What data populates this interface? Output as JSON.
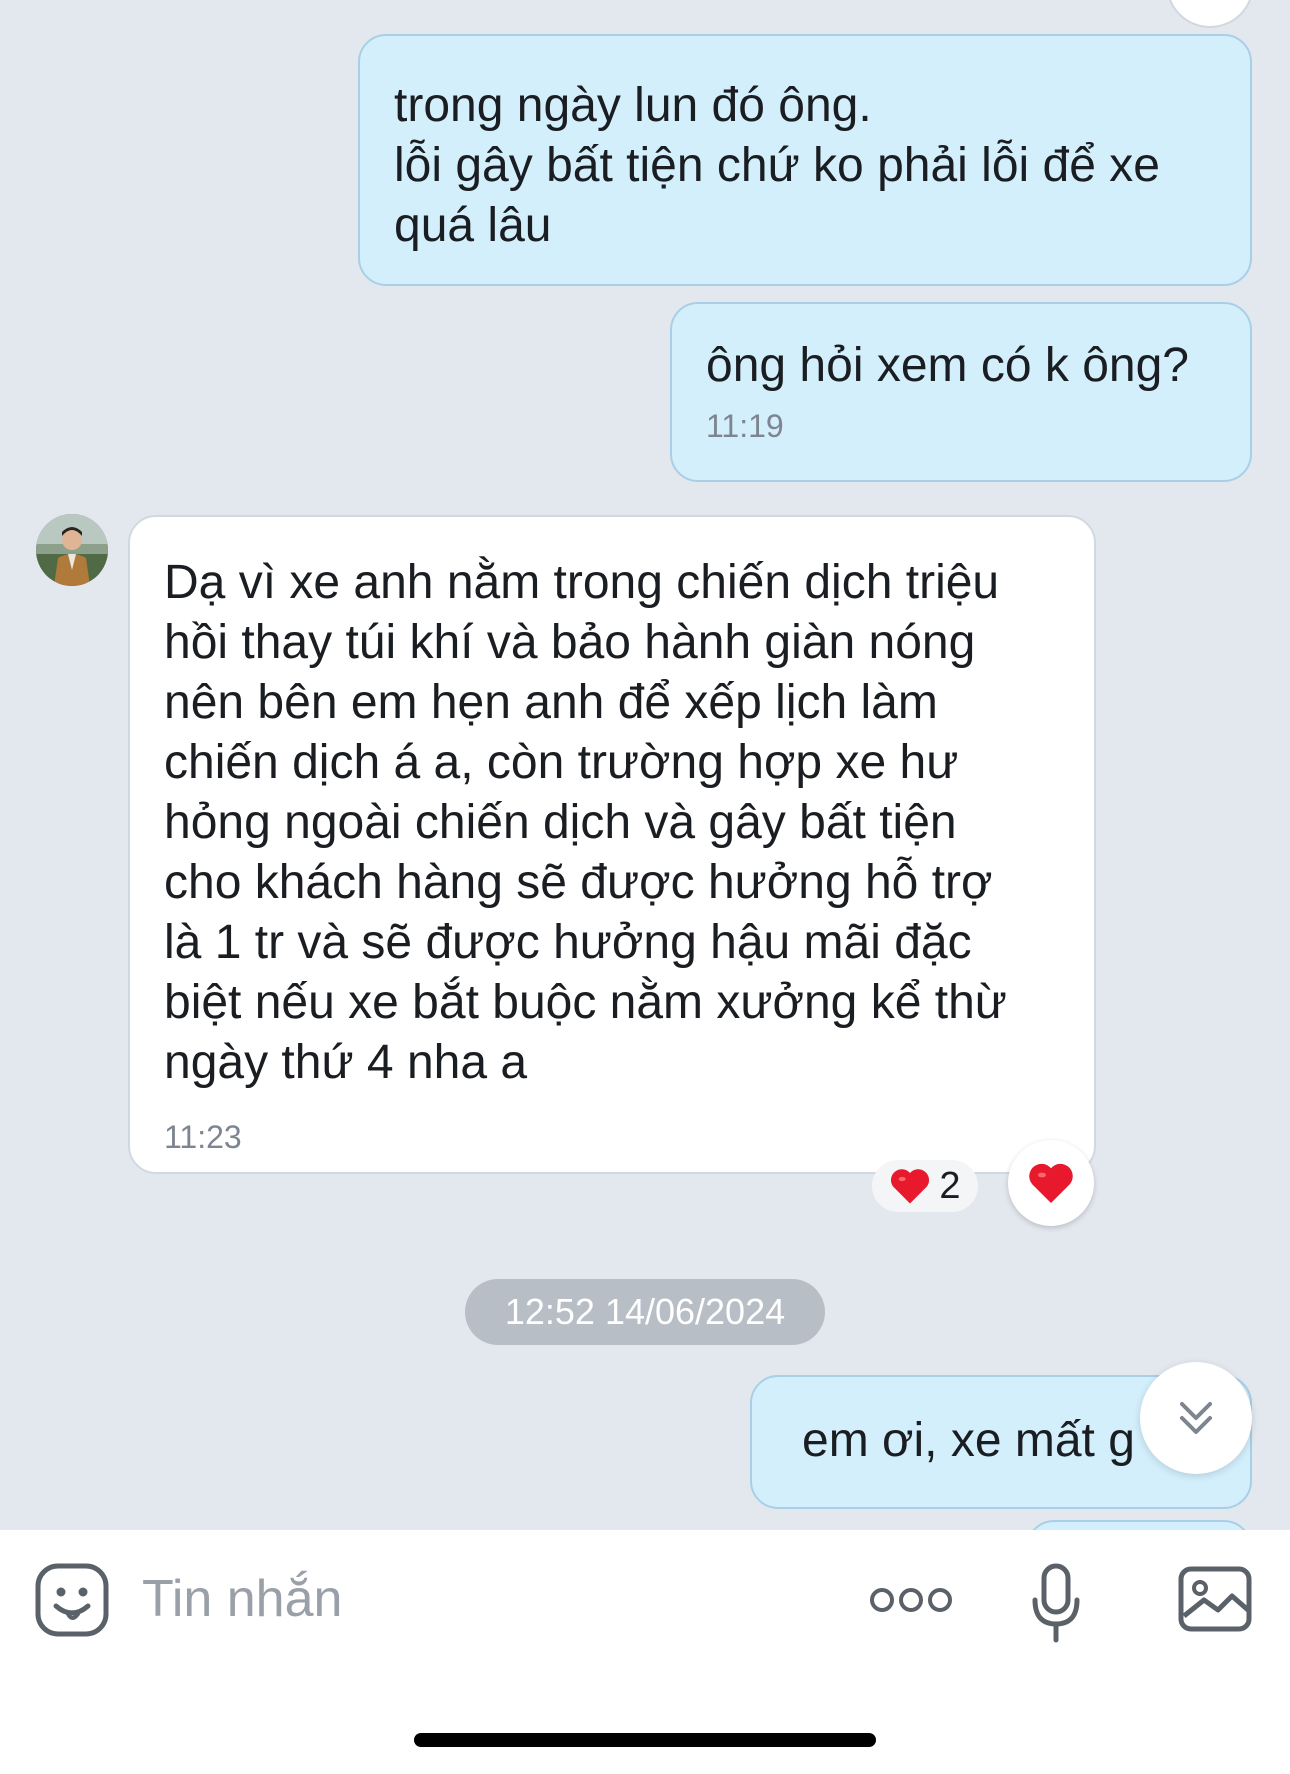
{
  "messages": [
    {
      "direction": "out",
      "text": "trong ngày lun đó ông.\nlỗi gây bất tiện chứ ko phải lỗi để xe\nquá lâu",
      "time": ""
    },
    {
      "direction": "out",
      "text": "ông hỏi xem có k ông?",
      "time": "11:19"
    },
    {
      "direction": "in",
      "text": "Dạ vì xe anh nằm trong chiến dịch triệu\nhồi thay túi khí và bảo hành giàn nóng\nnên bên em hẹn anh để xếp lịch làm\nchiến dịch á a, còn trường hợp xe hư\nhỏng ngoài chiến dịch và gây bất tiện\ncho khách hàng sẽ được hưởng hỗ trợ\nlà 1 tr và sẽ được hưởng hậu mãi đặc\nbiệt nếu xe bắt buộc nằm xưởng kể thừ\nngày thứ 4 nha a",
      "time": "11:23",
      "reaction_count": "2"
    },
    {
      "direction": "out",
      "text": "em ơi, xe mất g",
      "time": ""
    }
  ],
  "date_separator": "12:52 14/06/2024",
  "composer": {
    "placeholder": "Tin nhắn"
  },
  "icons": {
    "emoji": "smiley-icon",
    "more": "more-dots-icon",
    "mic": "microphone-icon",
    "image": "image-icon",
    "scroll": "double-chevron-down-icon",
    "reaction": "heart-icon"
  },
  "colors": {
    "outgoing_bubble": "#d3effc",
    "incoming_bubble": "#ffffff",
    "background": "#e3e8ef",
    "heart": "#e8192c"
  }
}
